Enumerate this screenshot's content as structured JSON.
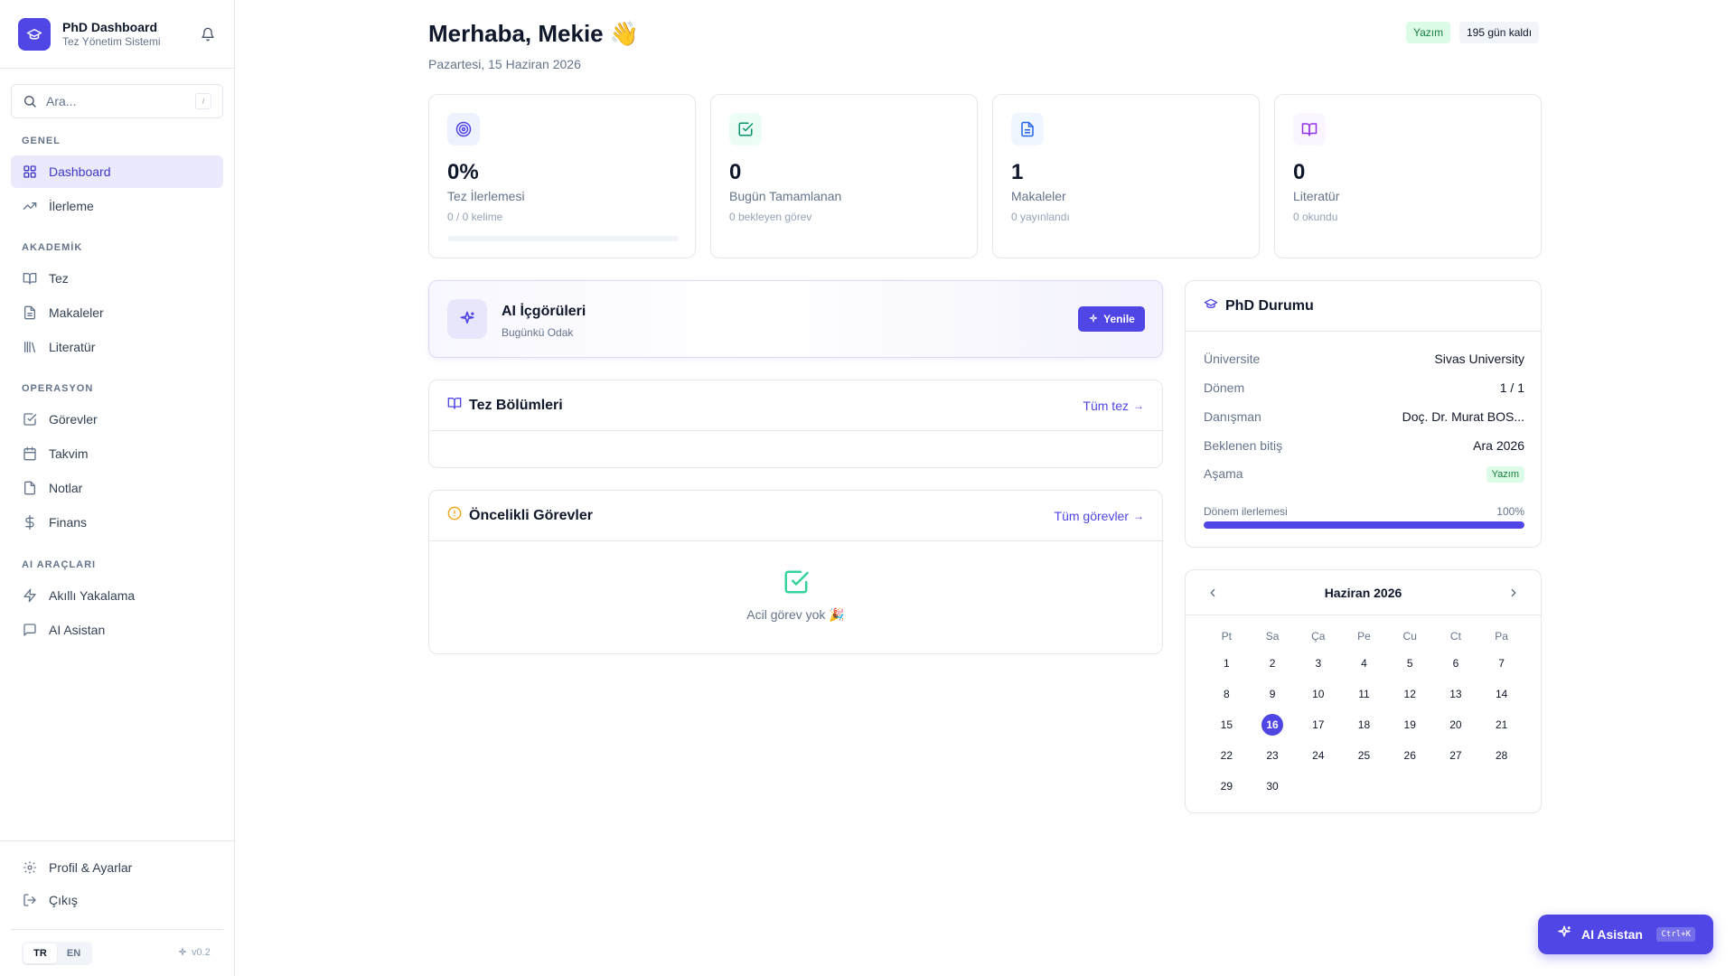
{
  "brand": {
    "title": "PhD Dashboard",
    "subtitle": "Tez Yönetim Sistemi"
  },
  "search": {
    "placeholder": "Ara...",
    "shortcut": "/"
  },
  "nav": {
    "sections": {
      "general": "GENEL",
      "academic": "AKADEMİK",
      "operations": "OPERASYON",
      "ai_tools": "AI ARAÇLARI"
    },
    "items": {
      "dashboard": "Dashboard",
      "progress": "İlerleme",
      "thesis": "Tez",
      "articles": "Makaleler",
      "literature": "Literatür",
      "tasks": "Görevler",
      "calendar": "Takvim",
      "notes": "Notlar",
      "finance": "Finans",
      "smart_capture": "Akıllı Yakalama",
      "ai_assistant": "AI Asistan"
    },
    "bottom": {
      "profile": "Profil & Ayarlar",
      "logout": "Çıkış"
    },
    "lang": {
      "tr": "TR",
      "en": "EN"
    },
    "version": "v0.2"
  },
  "header": {
    "greeting": "Merhaba, Mekie 👋",
    "date": "Pazartesi, 15 Haziran 2026",
    "stage_badge": "Yazım",
    "days_left": "195 gün kaldı"
  },
  "stats": {
    "thesis": {
      "value": "0%",
      "label": "Tez İlerlemesi",
      "sub": "0 / 0 kelime",
      "progress": 0
    },
    "today": {
      "value": "0",
      "label": "Bugün Tamamlanan",
      "sub": "0 bekleyen görev"
    },
    "articles": {
      "value": "1",
      "label": "Makaleler",
      "sub": "0 yayınlandı"
    },
    "literature": {
      "value": "0",
      "label": "Literatür",
      "sub": "0 okundu"
    }
  },
  "ai_insights": {
    "title": "AI İçgörüleri",
    "subtitle": "Bugünkü Odak",
    "button": "Yenile"
  },
  "chapters": {
    "title": "Tez Bölümleri",
    "link": "Tüm tez"
  },
  "priority": {
    "title": "Öncelikli Görevler",
    "link": "Tüm görevler",
    "empty": "Acil görev yok 🎉"
  },
  "phd_status": {
    "title": "PhD Durumu",
    "rows": {
      "university": {
        "key": "Üniversite",
        "value": "Sivas University"
      },
      "term": {
        "key": "Dönem",
        "value": "1 / 1"
      },
      "advisor": {
        "key": "Danışman",
        "value": "Doç. Dr. Murat BOS..."
      },
      "expected_end": {
        "key": "Beklenen bitiş",
        "value": "Ara 2026"
      },
      "stage": {
        "key": "Aşama",
        "value": "Yazım"
      }
    },
    "progress_label": "Dönem ilerlemesi",
    "progress_value": "100%",
    "progress": 100
  },
  "calendar": {
    "month": "Haziran 2026",
    "weekdays": [
      "Pt",
      "Sa",
      "Ça",
      "Pe",
      "Cu",
      "Ct",
      "Pa"
    ],
    "days": [
      "1",
      "2",
      "3",
      "4",
      "5",
      "6",
      "7",
      "8",
      "9",
      "10",
      "11",
      "12",
      "13",
      "14",
      "15",
      "16",
      "17",
      "18",
      "19",
      "20",
      "21",
      "22",
      "23",
      "24",
      "25",
      "26",
      "27",
      "28",
      "29",
      "30"
    ],
    "today": "16"
  },
  "fab": {
    "label": "AI Asistan",
    "shortcut": "Ctrl+K"
  },
  "colors": {
    "accent": "#4f46e5",
    "success": "#15803d",
    "success_bg": "#dcfce7"
  }
}
